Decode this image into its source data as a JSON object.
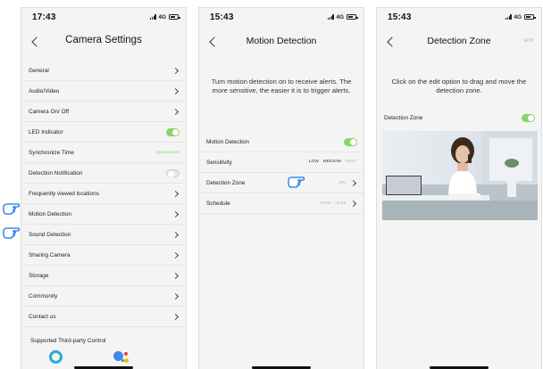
{
  "accent_color": "#8bd466",
  "screen1": {
    "status": {
      "time": "17:43",
      "network": "4G"
    },
    "title": "Camera Settings",
    "back_icon": "chevron-left-icon",
    "rows": [
      {
        "label": "General"
      },
      {
        "label": "Audio/Video"
      },
      {
        "label": "Camera On/ Off"
      },
      {
        "label": "LED Indicator",
        "toggle": "on"
      },
      {
        "label": "Synchronize Time",
        "value": "Synchronize"
      },
      {
        "label": "Detection Notification",
        "toggle": "off"
      },
      {
        "label": "Frequently viewed locations"
      },
      {
        "label": "Motion Detection"
      },
      {
        "label": "Sound Detection"
      },
      {
        "label": "Sharing Camera"
      },
      {
        "label": "Storage"
      },
      {
        "label": "Community"
      },
      {
        "label": "Contact us"
      }
    ],
    "third_party_title": "Supported Third-party Control",
    "third_party_icons": [
      "alexa-icon",
      "google-assistant-icon"
    ],
    "pointer_icons": [
      "hand-pointer-icon",
      "hand-pointer-icon"
    ]
  },
  "screen2": {
    "status": {
      "time": "15:43",
      "network": "4G"
    },
    "title": "Motion Detection",
    "description": "Turn motion detection on to receive alerts. The more sensitive, the easier it is to trigger alerts.",
    "motion_detection": {
      "label": "Motion Detection",
      "toggle": "on"
    },
    "sensitivity": {
      "label": "Sensitivity",
      "options": [
        "LOW",
        "MEDIUM",
        "HIGH"
      ],
      "selected": "HIGH"
    },
    "detection_zone": {
      "label": "Detection Zone",
      "value": "ON"
    },
    "schedule": {
      "label": "Schedule",
      "value": "00:00 - 23:59"
    }
  },
  "screen3": {
    "status": {
      "time": "15:43",
      "network": "4G"
    },
    "title": "Detection Zone",
    "edit_label": "EDIT",
    "description": "Click on the edit option to drag and move the detection zone.",
    "zone_toggle": {
      "label": "Detection Zone",
      "toggle": "on"
    },
    "camera_view": "camera-preview-image"
  }
}
